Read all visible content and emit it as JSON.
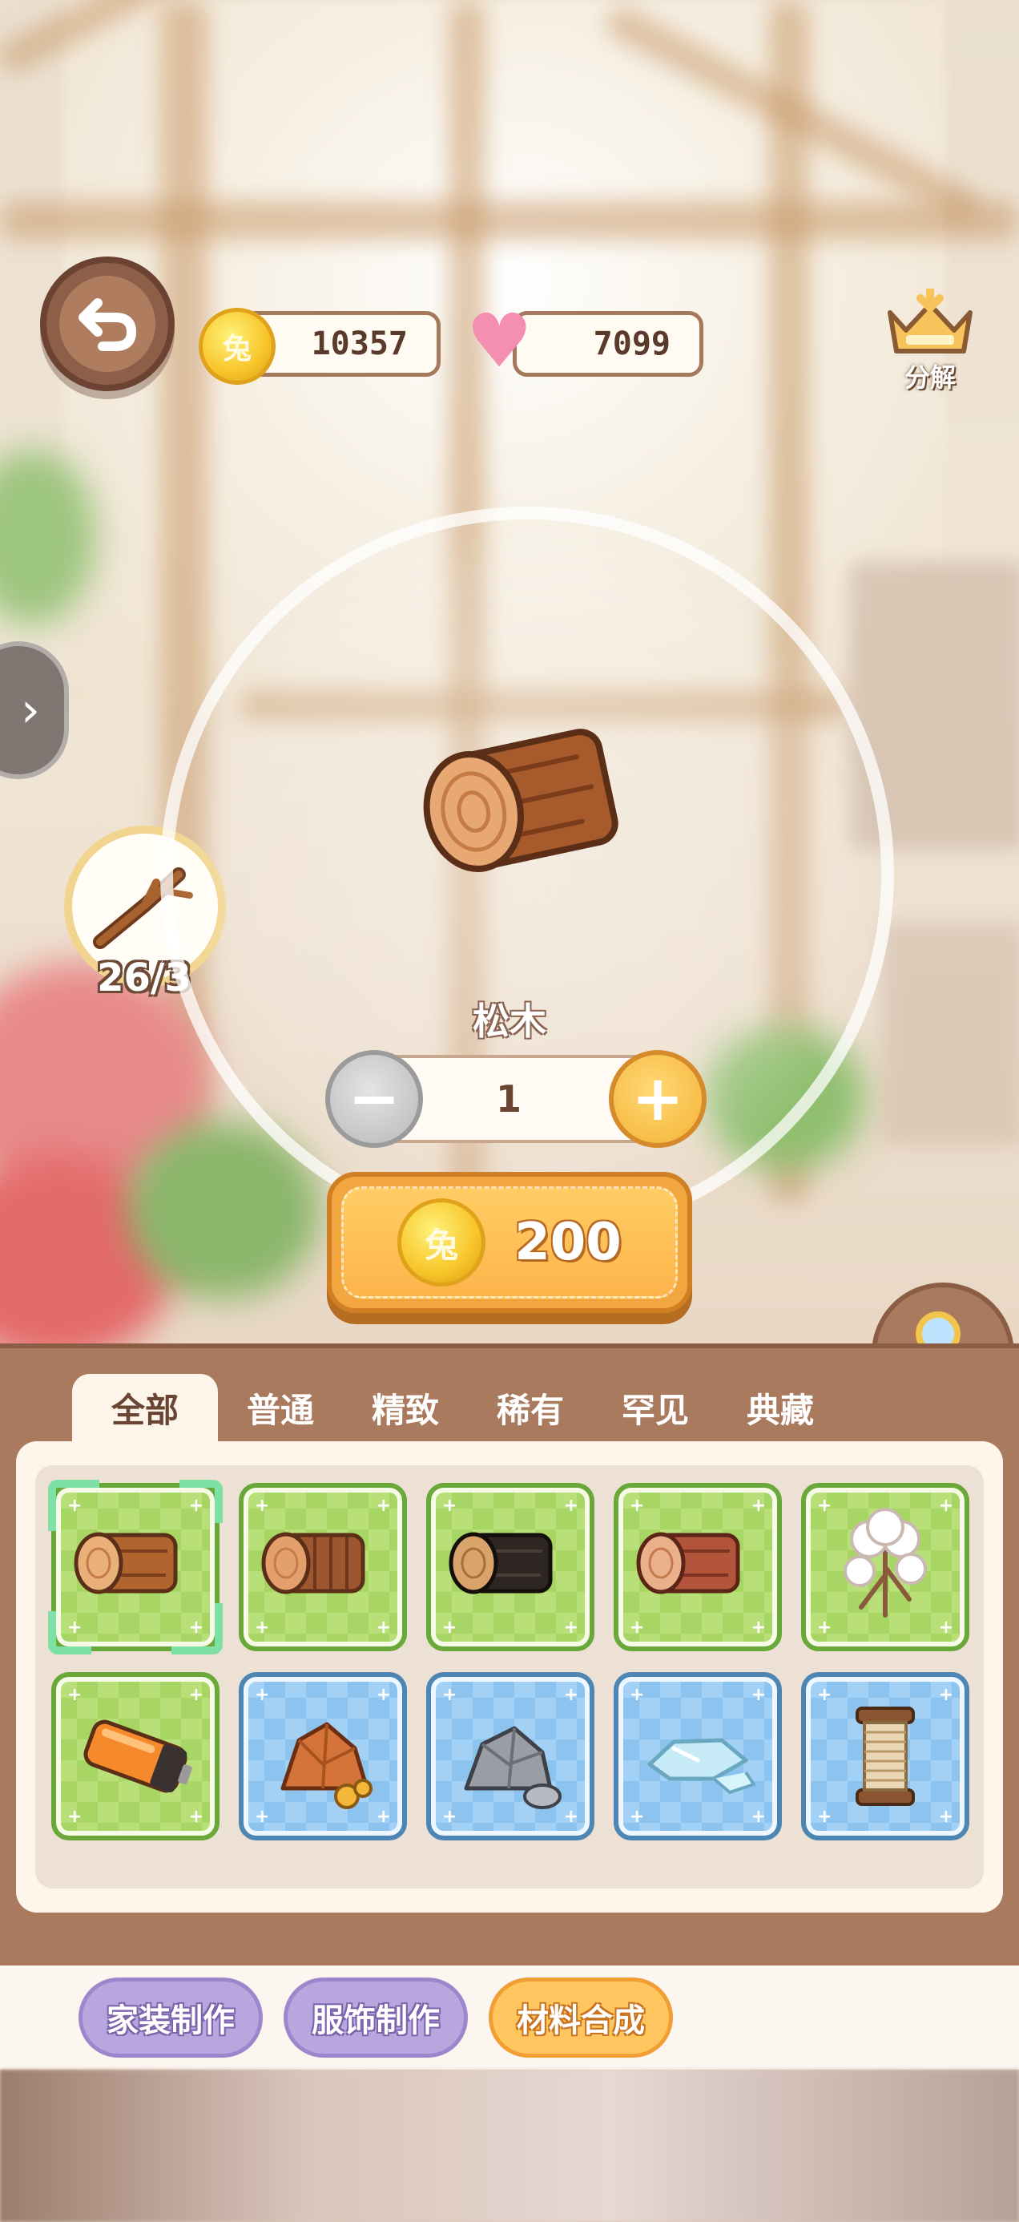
{
  "header": {
    "coins": "10357",
    "hearts": "7099",
    "decompose_label": "分解",
    "coin_symbol": "兔"
  },
  "ingredient": {
    "icon": "branch-icon",
    "count": "26/3"
  },
  "craft": {
    "item_name": "松木",
    "quantity": "1",
    "minus_label": "−",
    "plus_label": "+",
    "price": "200"
  },
  "tabs": [
    {
      "label": "全部",
      "active": true
    },
    {
      "label": "普通",
      "active": false
    },
    {
      "label": "精致",
      "active": false
    },
    {
      "label": "稀有",
      "active": false
    },
    {
      "label": "罕见",
      "active": false
    },
    {
      "label": "典藏",
      "active": false
    }
  ],
  "items": [
    {
      "icon": "pine-log-icon",
      "bg": "green",
      "selected": true
    },
    {
      "icon": "striped-log-icon",
      "bg": "green",
      "selected": false
    },
    {
      "icon": "dark-log-icon",
      "bg": "green",
      "selected": false
    },
    {
      "icon": "red-log-icon",
      "bg": "green",
      "selected": false
    },
    {
      "icon": "cotton-icon",
      "bg": "green",
      "selected": false
    },
    {
      "icon": "battery-icon",
      "bg": "green",
      "selected": false
    },
    {
      "icon": "copper-ore-icon",
      "bg": "blue",
      "selected": false
    },
    {
      "icon": "stone-icon",
      "bg": "blue",
      "selected": false
    },
    {
      "icon": "ice-crystal-icon",
      "bg": "blue",
      "selected": false
    },
    {
      "icon": "thread-spool-icon",
      "bg": "blue",
      "selected": false
    }
  ],
  "nav": {
    "furniture_label": "家装制作",
    "clothing_label": "服饰制作",
    "material_label": "材料合成"
  },
  "colors": {
    "panel": "#a97a5e",
    "accent": "#ffc65f",
    "purple": "#b9a6df"
  }
}
